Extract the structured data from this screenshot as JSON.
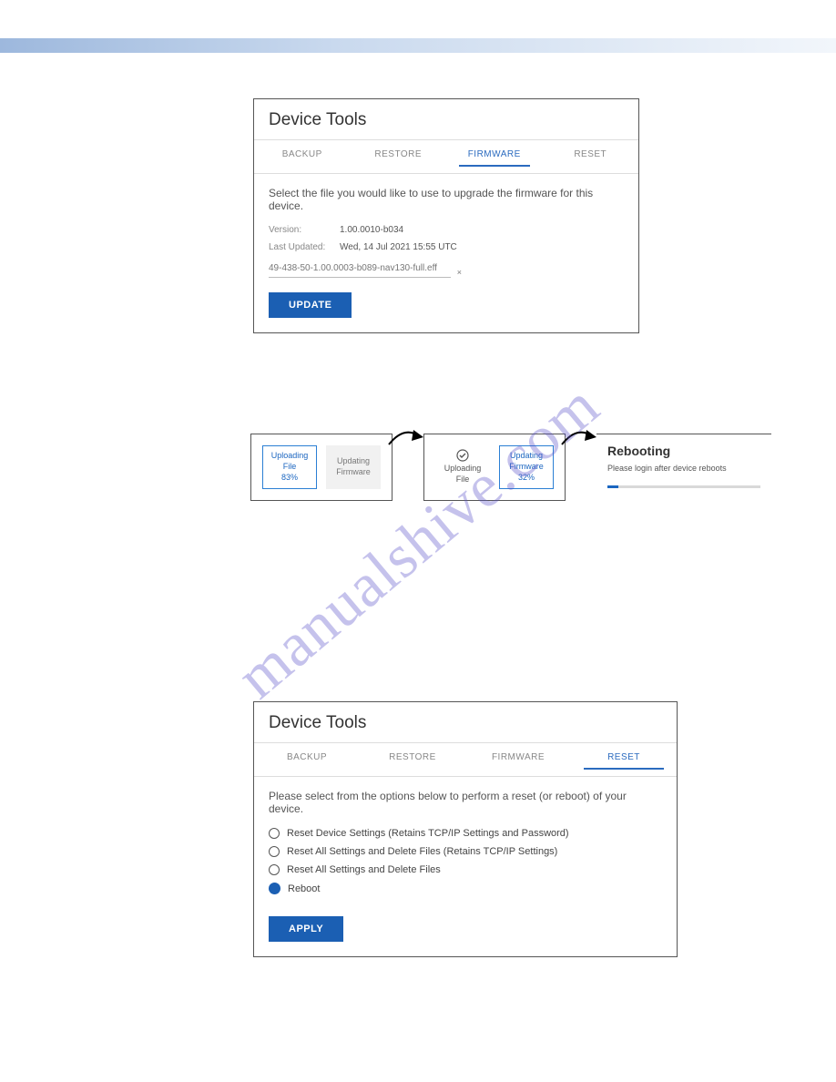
{
  "watermark": "manualshive.com",
  "panel1": {
    "title": "Device Tools",
    "tabs": {
      "backup": "BACKUP",
      "restore": "RESTORE",
      "firmware": "FIRMWARE",
      "reset": "RESET"
    },
    "instruction": "Select the file you would like to use to upgrade the firmware for this device.",
    "version_label": "Version:",
    "version_value": "1.00.0010-b034",
    "updated_label": "Last Updated:",
    "updated_value": "Wed, 14 Jul 2021 15:55 UTC",
    "filename": "49-438-50-1.00.0003-b089-nav130-full.eff",
    "file_clear": "×",
    "update_button": "UPDATE"
  },
  "progress": {
    "stage1": {
      "uploading": "Uploading",
      "file": "File",
      "pct": "83%",
      "upd": "Updating",
      "fw": "Firmware"
    },
    "stage2": {
      "uploading": "Uploading",
      "file": "File",
      "upd": "Updating",
      "fw": "Firmware",
      "pct": "32%"
    },
    "stage3": {
      "title": "Rebooting",
      "sub": "Please login after device reboots"
    }
  },
  "panel2": {
    "title": "Device Tools",
    "tabs": {
      "backup": "BACKUP",
      "restore": "RESTORE",
      "firmware": "FIRMWARE",
      "reset": "RESET"
    },
    "instruction": "Please select from the options below to perform a reset (or reboot) of your device.",
    "opts": [
      "Reset Device Settings (Retains TCP/IP Settings and Password)",
      "Reset All Settings and Delete Files (Retains TCP/IP Settings)",
      "Reset All Settings and Delete Files",
      "Reboot"
    ],
    "apply_button": "APPLY"
  }
}
